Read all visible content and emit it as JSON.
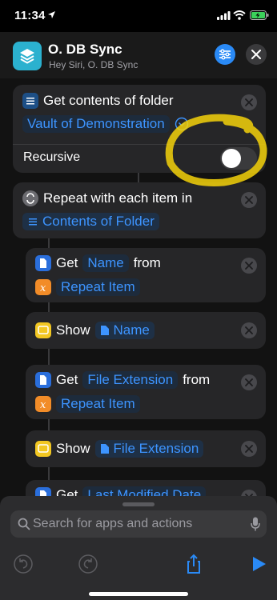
{
  "status": {
    "time": "11:34"
  },
  "header": {
    "title": "O. DB Sync",
    "subtitle": "Hey Siri, O. DB Sync"
  },
  "actions": {
    "get_contents": {
      "label": "Get contents of folder",
      "folder": "Vault of Demonstration",
      "recursive_label": "Recursive",
      "recursive_on": false
    },
    "repeat": {
      "label": "Repeat with each item in",
      "input": "Contents of Folder"
    },
    "get_name": {
      "get": "Get",
      "property": "Name",
      "from": "from",
      "source": "Repeat Item"
    },
    "show_name": {
      "show": "Show",
      "value": "Name"
    },
    "get_ext": {
      "get": "Get",
      "property": "File Extension",
      "from": "from",
      "source": "Repeat Item"
    },
    "show_ext": {
      "show": "Show",
      "value": "File Extension"
    },
    "get_modified": {
      "get": "Get",
      "property": "Last Modified Date"
    }
  },
  "search": {
    "placeholder": "Search for apps and actions"
  },
  "colors": {
    "accent": "#3d94ff",
    "highlight": "#f5d20a"
  }
}
